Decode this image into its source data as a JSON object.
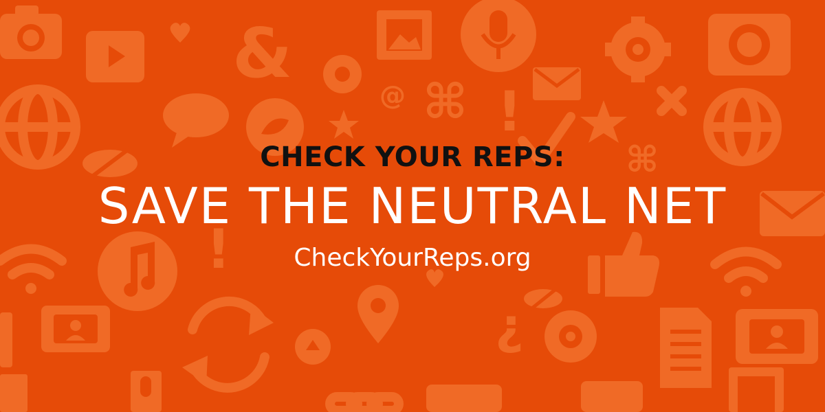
{
  "banner": {
    "kicker": "CHECK YOUR REPS:",
    "headline": "SAVE THE NEUTRAL NET",
    "url": "CheckYourReps.org"
  },
  "colors": {
    "background": "#e64b08",
    "pattern": "#f06a26",
    "kicker_text": "#111111",
    "headline_text": "#ffffff"
  },
  "pattern_icons": [
    "camera-icon",
    "heart-icon",
    "video-play-icon",
    "ampersand-icon",
    "image-icon",
    "microphone-icon",
    "gear-icon",
    "envelope-icon",
    "globe-icon",
    "speech-bubble-icon",
    "bird-icon",
    "at-sign-icon",
    "command-key-icon",
    "exclamation-icon",
    "star-icon",
    "checkmark-icon",
    "close-icon",
    "hidden-eye-icon",
    "music-note-icon",
    "thumbs-up-icon",
    "wifi-icon",
    "map-pin-icon",
    "refresh-icon",
    "document-icon",
    "contact-card-icon",
    "chain-link-icon",
    "question-mark-icon"
  ]
}
